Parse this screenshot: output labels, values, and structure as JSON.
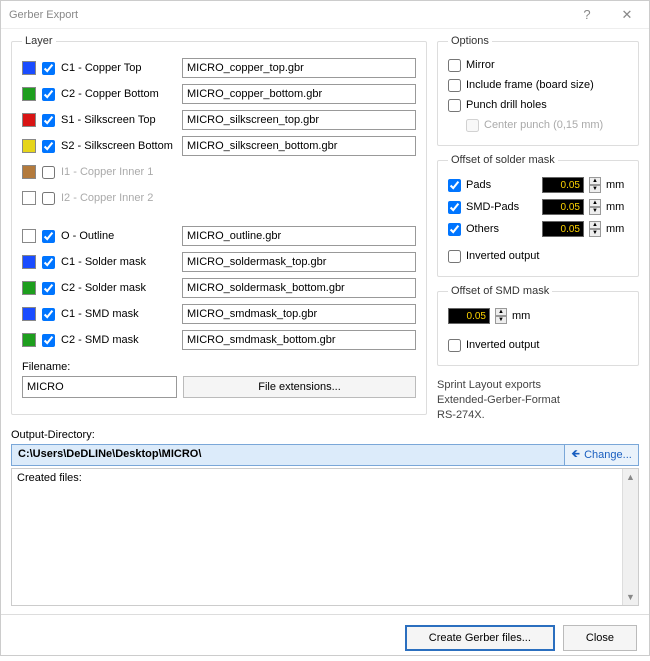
{
  "window": {
    "title": "Gerber Export"
  },
  "groups": {
    "layer": "Layer",
    "options": "Options",
    "solder": "Offset of solder mask",
    "smd": "Offset of SMD mask"
  },
  "layers": [
    {
      "color": "#1a4cff",
      "checked": true,
      "label": "C1 - Copper Top",
      "file": "MICRO_copper_top.gbr"
    },
    {
      "color": "#1e9e1e",
      "checked": true,
      "label": "C2 - Copper Bottom",
      "file": "MICRO_copper_bottom.gbr"
    },
    {
      "color": "#d81414",
      "checked": true,
      "label": "S1 - Silkscreen Top",
      "file": "MICRO_silkscreen_top.gbr"
    },
    {
      "color": "#e6d51a",
      "checked": true,
      "label": "S2 - Silkscreen Bottom",
      "file": "MICRO_silkscreen_bottom.gbr"
    },
    {
      "color": "#b37a3c",
      "checked": false,
      "label": "I1 - Copper Inner 1",
      "file": null,
      "dim": true
    },
    {
      "color": "#ffffff",
      "checked": false,
      "label": "I2 - Copper Inner 2",
      "file": null,
      "dim": true
    },
    {
      "color": "#ffffff",
      "checked": true,
      "label": "O - Outline",
      "file": "MICRO_outline.gbr",
      "gapBefore": true
    },
    {
      "color": "#1a4cff",
      "checked": true,
      "label": "C1 - Solder mask",
      "file": "MICRO_soldermask_top.gbr"
    },
    {
      "color": "#1e9e1e",
      "checked": true,
      "label": "C2 - Solder mask",
      "file": "MICRO_soldermask_bottom.gbr"
    },
    {
      "color": "#1a4cff",
      "checked": true,
      "label": "C1 - SMD mask",
      "file": "MICRO_smdmask_top.gbr"
    },
    {
      "color": "#1e9e1e",
      "checked": true,
      "label": "C2 - SMD mask",
      "file": "MICRO_smdmask_bottom.gbr"
    }
  ],
  "filename": {
    "label": "Filename:",
    "value": "MICRO",
    "extBtn": "File extensions..."
  },
  "options": {
    "mirror": {
      "label": "Mirror",
      "checked": false
    },
    "frame": {
      "label": "Include frame (board size)",
      "checked": false
    },
    "punch": {
      "label": "Punch drill holes",
      "checked": false
    },
    "center": {
      "label": "Center punch (0,15 mm)",
      "checked": false
    }
  },
  "solderOffset": {
    "pads": {
      "label": "Pads",
      "checked": true,
      "value": "0.05",
      "unit": "mm"
    },
    "smdpads": {
      "label": "SMD-Pads",
      "checked": true,
      "value": "0.05",
      "unit": "mm"
    },
    "others": {
      "label": "Others",
      "checked": true,
      "value": "0.05",
      "unit": "mm"
    },
    "invert": {
      "label": "Inverted output",
      "checked": false
    }
  },
  "smdOffset": {
    "value": "0.05",
    "unit": "mm",
    "invert": {
      "label": "Inverted output",
      "checked": false
    }
  },
  "info": "Sprint Layout exports\nExtended-Gerber-Format\nRS-274X.",
  "output": {
    "label": "Output-Directory:",
    "path": "C:\\Users\\DeDLINe\\Desktop\\MICRO\\",
    "changeBtn": "Change...",
    "createdLabel": "Created files:"
  },
  "buttons": {
    "create": "Create Gerber files...",
    "close": "Close"
  }
}
